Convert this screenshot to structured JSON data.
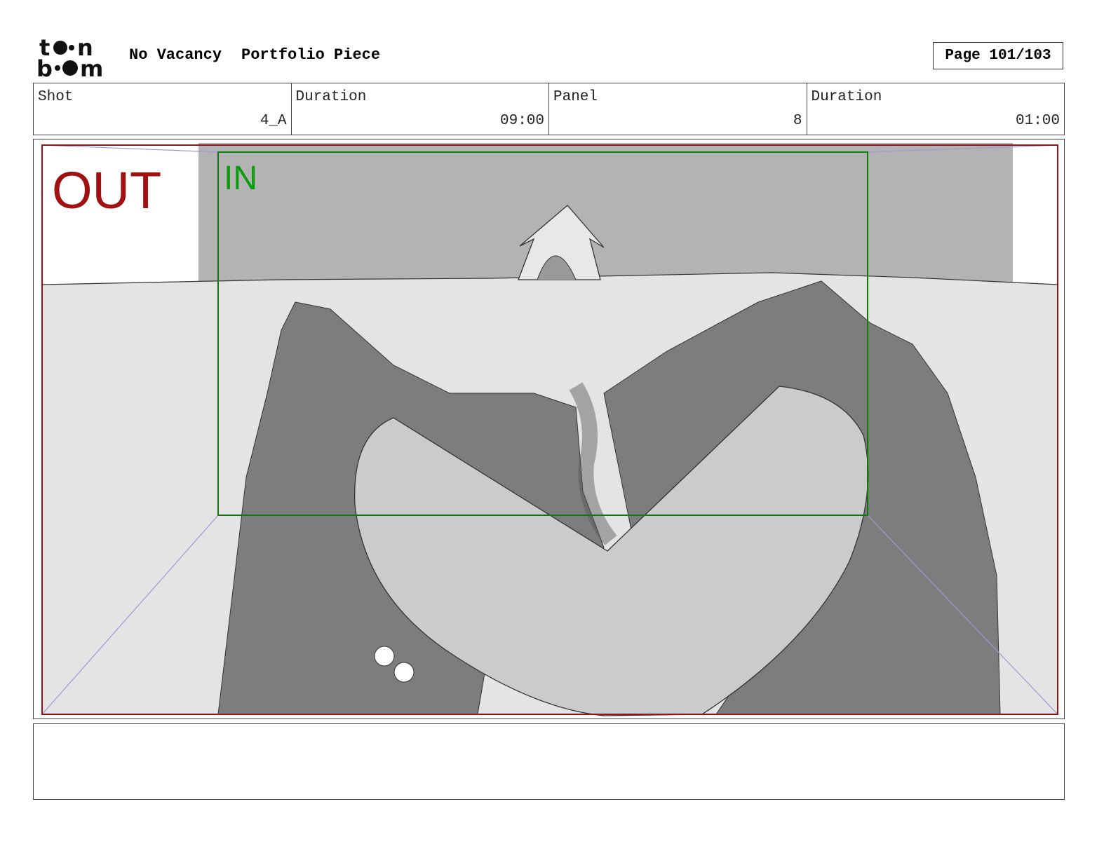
{
  "header": {
    "logo_text": "toon boom",
    "project": "No Vacancy",
    "subtitle": "Portfolio Piece",
    "page": "Page 101/103"
  },
  "info": [
    {
      "label": "Shot",
      "value": "4_A"
    },
    {
      "label": "Duration",
      "value": "09:00"
    },
    {
      "label": "Panel",
      "value": "8"
    },
    {
      "label": "Duration",
      "value": "01:00"
    }
  ],
  "panel": {
    "out_label": "OUT",
    "in_label": "IN"
  },
  "colors": {
    "out_frame": "#a01010",
    "in_frame": "#0d7a0d"
  }
}
